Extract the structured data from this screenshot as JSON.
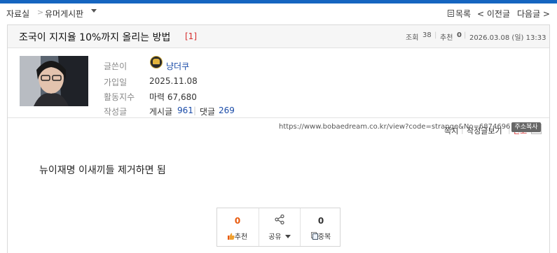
{
  "breadcrumb": {
    "section": "자료실",
    "separator": ">",
    "board": "유머게시판"
  },
  "nav": {
    "list_label": "목록",
    "prev_label": "< 이전글",
    "next_label": "다음글 >"
  },
  "post": {
    "title": "조국이 지지율 10%까지 올리는 방법",
    "comment_count": "[1]",
    "views_label": "조회",
    "views": "38",
    "recommends_label": "추천",
    "recommends": "0",
    "datetime": "2026.03.08 (일) 13:33",
    "body": "뉴이재명 이새끼들 제거하면 됨",
    "url": "https://www.bobaedream.co.kr/view?code=strange&No=6874696",
    "copy_url_label": "주소복사"
  },
  "author": {
    "writer_label": "글쓴이",
    "nickname": "냥더쿠",
    "joined_label": "가입일",
    "joined": "2025.11.08",
    "activity_label": "활동지수",
    "activity_value": "마력 67,680",
    "posts_label": "작성글",
    "posts_text": "게시글",
    "posts_count": "961",
    "comments_text": "댓글",
    "comments_count": "269"
  },
  "utilities": {
    "message": "쪽지",
    "view_posts": "작성글보기",
    "report": "신고"
  },
  "actions": {
    "recommend_count": "0",
    "recommend_label": "추천",
    "share_label": "공유",
    "duplicate_count": "0",
    "duplicate_label": "중복"
  },
  "colors": {
    "accent_blue": "#1565c0",
    "count_red": "#d62d2d",
    "recommend_orange": "#e8590c",
    "link_blue": "#1a4ba8"
  }
}
